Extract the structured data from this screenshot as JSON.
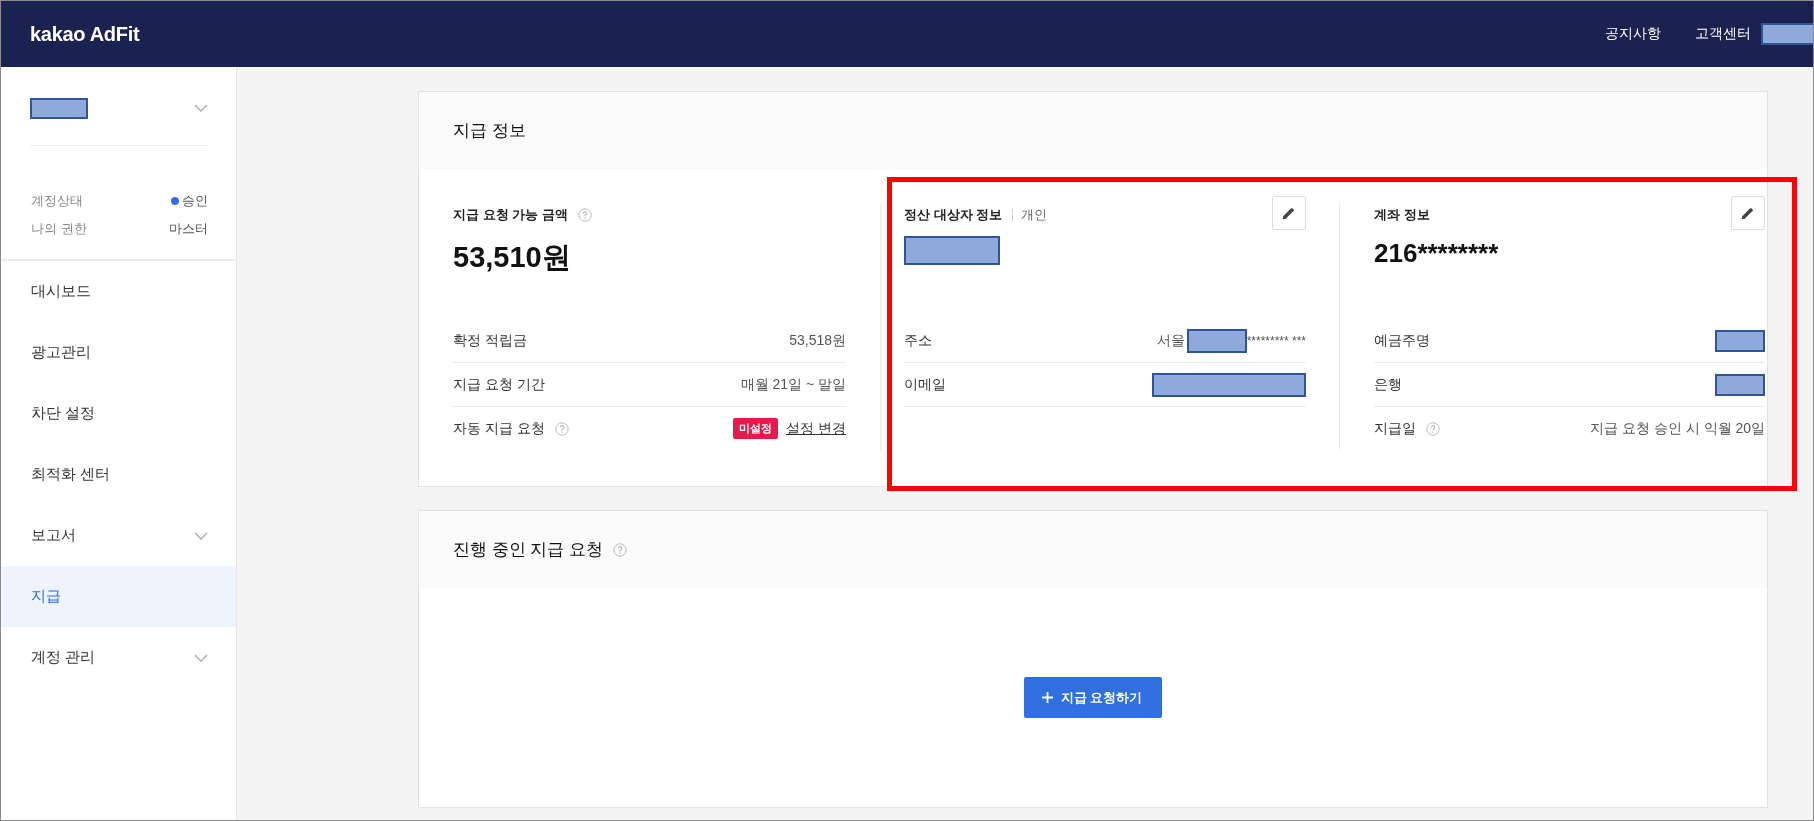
{
  "header": {
    "logo": "kakao AdFit",
    "links": [
      "공지사항",
      "고객센터"
    ]
  },
  "sidebar": {
    "status_rows": [
      {
        "label": "계정상태",
        "value": "승인",
        "color": "#3b6fe0"
      },
      {
        "label": "나의 권한",
        "value": "마스터"
      }
    ],
    "items": [
      {
        "label": "대시보드",
        "selected": false,
        "has_submenu": false
      },
      {
        "label": "광고관리",
        "selected": false,
        "has_submenu": false
      },
      {
        "label": "차단 설정",
        "selected": false,
        "has_submenu": false
      },
      {
        "label": "최적화 센터",
        "selected": false,
        "has_submenu": false
      },
      {
        "label": "보고서",
        "selected": false,
        "has_submenu": true
      },
      {
        "label": "지급",
        "selected": true,
        "has_submenu": false
      },
      {
        "label": "계정 관리",
        "selected": false,
        "has_submenu": true
      }
    ]
  },
  "payment_info": {
    "title": "지급 정보",
    "available": {
      "label": "지급 요청 가능 금액",
      "help": true,
      "amount": "53,510원",
      "rows": [
        {
          "kind": "text",
          "label": "확정 적립금",
          "value": "53,518원"
        },
        {
          "kind": "text",
          "label": "지급 요청 기간",
          "value": "매월 21일 ~ 말일"
        },
        {
          "kind": "setting",
          "label": "자동 지급 요청",
          "help": true,
          "badge": "미설정",
          "link": "설정 변경"
        }
      ]
    },
    "payee": {
      "title": "정산 대상자 정보",
      "type": "개인",
      "rows": [
        {
          "kind": "address",
          "label": "주소",
          "prefix": "서울",
          "suffix": "********* ***"
        },
        {
          "kind": "redacted",
          "label": "이메일"
        }
      ]
    },
    "account": {
      "title": "계좌 정보",
      "number": "216********",
      "rows": [
        {
          "kind": "redacted",
          "label": "예금주명"
        },
        {
          "kind": "redacted",
          "label": "은행"
        },
        {
          "kind": "text",
          "label": "지급일",
          "help": true,
          "value": "지급 요청 승인 시 익월 20일"
        }
      ]
    }
  },
  "pending": {
    "title": "진행 중인 지급 요청",
    "help": true,
    "button": "지급 요청하기"
  }
}
